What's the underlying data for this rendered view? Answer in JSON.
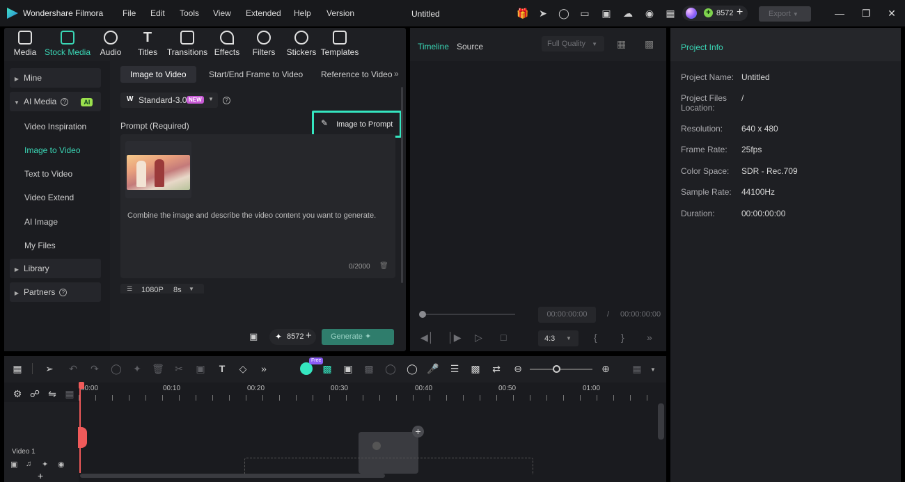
{
  "app": {
    "name": "Wondershare Filmora",
    "menu": [
      "File",
      "Edit",
      "Tools",
      "View",
      "Extended",
      "Help",
      "Version"
    ],
    "doc_title": "Untitled",
    "credits": "8572",
    "export_label": "Export"
  },
  "toolbar": {
    "categories": [
      {
        "label": "Media",
        "icon": "media-icon"
      },
      {
        "label": "Stock Media",
        "icon": "stock-media-icon"
      },
      {
        "label": "Audio",
        "icon": "audio-icon"
      },
      {
        "label": "Titles",
        "icon": "titles-icon"
      },
      {
        "label": "Transitions",
        "icon": "transitions-icon"
      },
      {
        "label": "Effects",
        "icon": "effects-icon"
      },
      {
        "label": "Filters",
        "icon": "filters-icon"
      },
      {
        "label": "Stickers",
        "icon": "stickers-icon"
      },
      {
        "label": "Templates",
        "icon": "templates-icon"
      }
    ]
  },
  "sidebar": {
    "mine": "Mine",
    "ai_media": "AI Media",
    "ai_badge": "AI",
    "sub_items": [
      "Video Inspiration",
      "Image to Video",
      "Text to Video",
      "Video Extend",
      "AI Image",
      "My Files"
    ],
    "library": "Library",
    "partners": "Partners"
  },
  "generator": {
    "tabs": [
      "Image to Video",
      "Start/End Frame to Video",
      "Reference to Video"
    ],
    "model": "Standard-3.0",
    "new_badge": "NEW",
    "prompt_label": "Prompt (Required)",
    "image_to_prompt": "Image to Prompt",
    "placeholder": "Combine the image and describe the video content you want to generate.",
    "char_count": "0/2000",
    "resolution": "1080P",
    "duration": "8s",
    "credits": "8572",
    "generate_label": "Generate"
  },
  "preview": {
    "tabs": [
      "Timeline",
      "Source"
    ],
    "quality": "Full Quality",
    "current_time": "00:00:00:00",
    "separator": "/",
    "total_time": "00:00:00:00",
    "aspect": "4:3"
  },
  "project_info": {
    "title": "Project Info",
    "fields": [
      {
        "label": "Project Name:",
        "value": "Untitled"
      },
      {
        "label": "Project Files Location:",
        "value": "/"
      },
      {
        "label": "Resolution:",
        "value": "640 x 480"
      },
      {
        "label": "Frame Rate:",
        "value": "25fps"
      },
      {
        "label": "Color Space:",
        "value": "SDR - Rec.709"
      },
      {
        "label": "Sample Rate:",
        "value": "44100Hz"
      },
      {
        "label": "Duration:",
        "value": "00:00:00:00"
      }
    ]
  },
  "timeline": {
    "ticks": [
      "00:00",
      "00:10",
      "00:20",
      "00:30",
      "00:40",
      "00:50",
      "01:00"
    ],
    "track_name": "Video 1",
    "free_badge": "Free"
  }
}
